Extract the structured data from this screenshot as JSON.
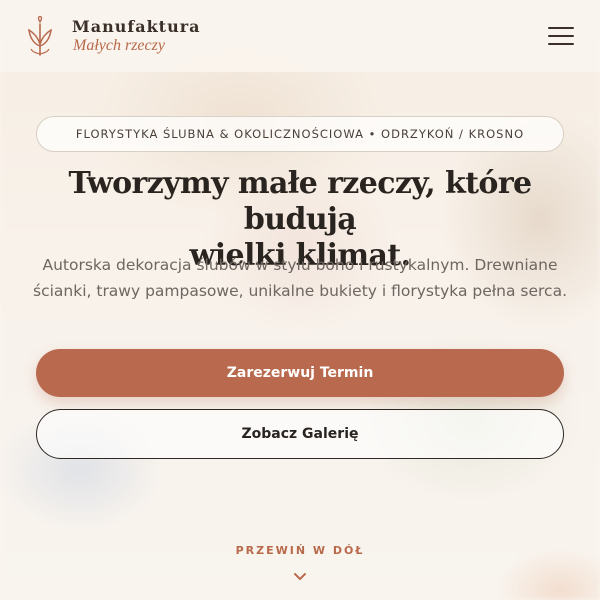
{
  "header": {
    "brand_title": "Manufaktura",
    "brand_subtitle": "Małych rzeczy",
    "logo_icon": "wheat-sprig-icon",
    "menu_icon": "hamburger-menu-icon"
  },
  "hero": {
    "tagline": "FLORYSTYKA ŚLUBNA & OKOLICZNOŚCIOWA • ODRZYKOŃ / KROSNO",
    "title_line1": "Tworzymy małe rzeczy, które budują",
    "title_line2": "wielki klimat.",
    "lead": "Autorska dekoracja ślubów w stylu boho i rustykalnym. Drewniane ścianki, trawy pampasowe, unikalne bukiety i florystyka pełna serca.",
    "primary_cta": "Zarezerwuj Termin",
    "secondary_cta": "Zobacz Galerię",
    "scroll_hint": "PRZEWIŃ W DÓŁ",
    "scroll_icon": "chevron-down-icon"
  },
  "colors": {
    "accent": "#b96a4e",
    "text_dark": "#2a2420",
    "text_muted": "#6e6660",
    "header_bg": "#faf4ee"
  }
}
